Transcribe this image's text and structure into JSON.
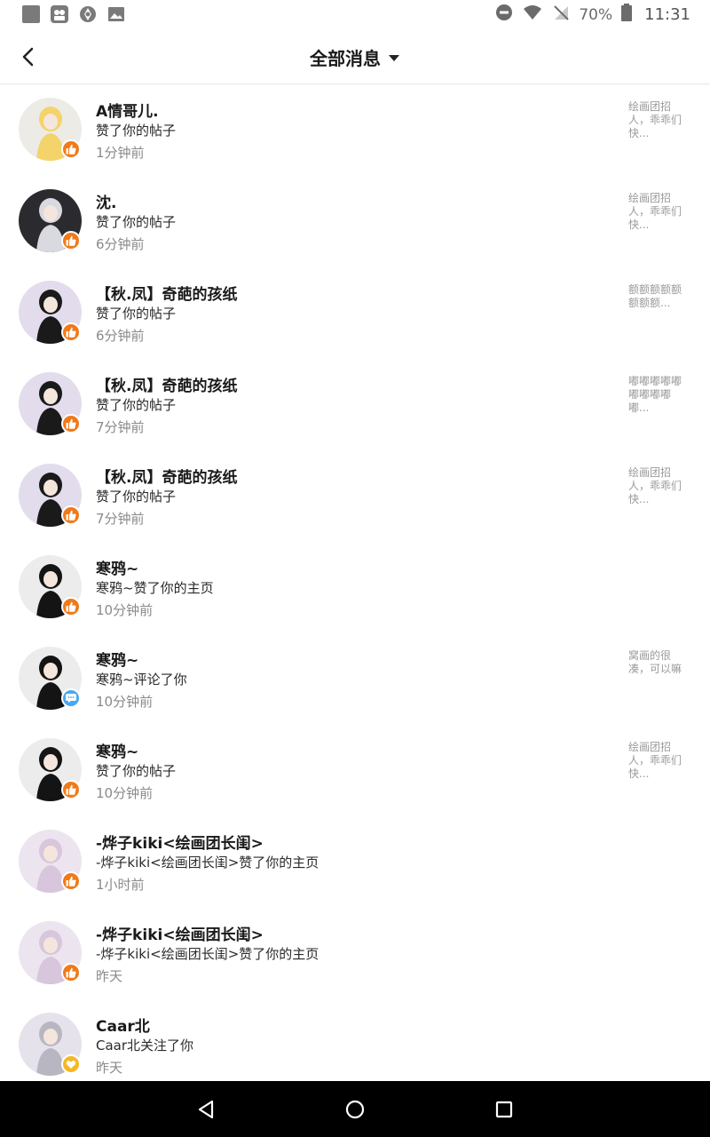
{
  "status_bar": {
    "battery": "70%",
    "time": "11:31"
  },
  "header": {
    "title": "全部消息"
  },
  "messages": [
    {
      "name": "A情哥儿.",
      "action": "赞了你的帖子",
      "time": "1分钟前",
      "preview": "绘画团招人，乖乖们快...",
      "badge": "like-icon"
    },
    {
      "name": "沈.",
      "action": "赞了你的帖子",
      "time": "6分钟前",
      "preview": "绘画团招人，乖乖们快...",
      "badge": "like-icon"
    },
    {
      "name": "【秋.凤】奇葩的孩纸",
      "action": "赞了你的帖子",
      "time": "6分钟前",
      "preview": "额额额额额额额额...",
      "badge": "like-icon"
    },
    {
      "name": "【秋.凤】奇葩的孩纸",
      "action": "赞了你的帖子",
      "time": "7分钟前",
      "preview": "嘟嘟嘟嘟嘟嘟嘟嘟嘟嘟...",
      "badge": "like-icon"
    },
    {
      "name": "【秋.凤】奇葩的孩纸",
      "action": "赞了你的帖子",
      "time": "7分钟前",
      "preview": "绘画团招人，乖乖们快...",
      "badge": "like-icon"
    },
    {
      "name": "寒鸦~",
      "action": "寒鸦~赞了你的主页",
      "time": "10分钟前",
      "preview": "",
      "badge": "like-icon"
    },
    {
      "name": "寒鸦~",
      "action": "寒鸦~评论了你",
      "time": "10分钟前",
      "preview": "窝画的很凑，可以嘛",
      "badge": "comment-icon"
    },
    {
      "name": "寒鸦~",
      "action": "赞了你的帖子",
      "time": "10分钟前",
      "preview": "绘画团招人，乖乖们快...",
      "badge": "like-icon"
    },
    {
      "name": "-烨子kiki<绘画团长闺>",
      "action": "-烨子kiki<绘画团长闺>赞了你的主页",
      "time": "1小时前",
      "preview": "",
      "badge": "like-icon"
    },
    {
      "name": "-烨子kiki<绘画团长闺>",
      "action": "-烨子kiki<绘画团长闺>赞了你的主页",
      "time": "昨天",
      "preview": "",
      "badge": "like-icon"
    },
    {
      "name": "Caar北",
      "action": "Caar北关注了你",
      "time": "昨天",
      "preview": "",
      "badge": "follow-icon"
    }
  ],
  "colors": {
    "like_badge": "#f07a1a",
    "comment_badge": "#4aa8f0",
    "follow_badge": "#f5b820",
    "nav_bar": "#000000"
  }
}
